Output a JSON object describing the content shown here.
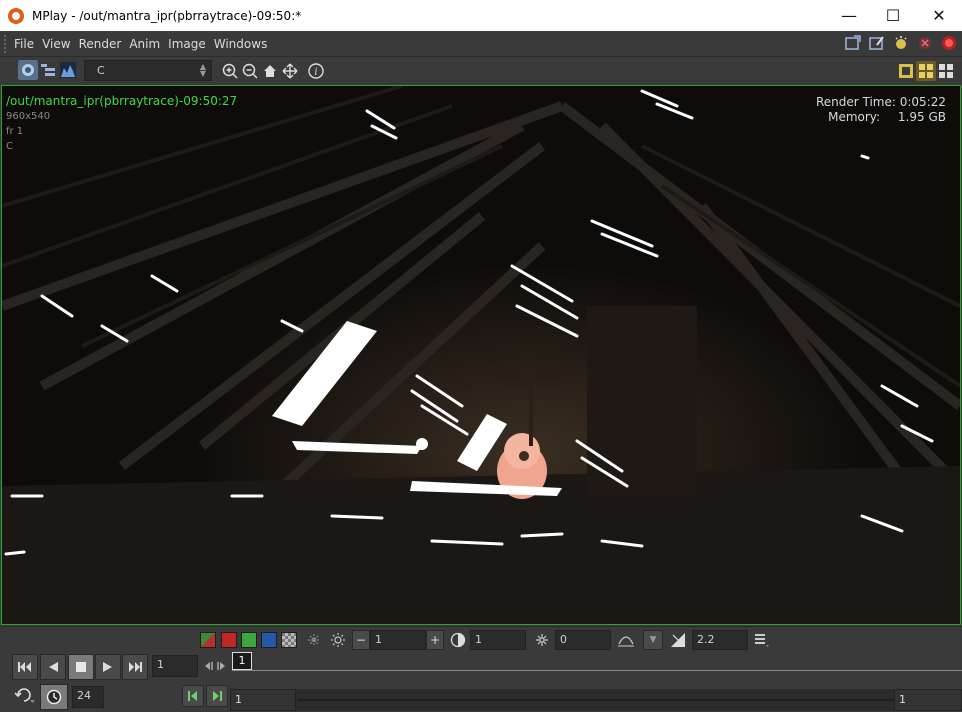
{
  "window": {
    "title": "MPlay - /out/mantra_ipr(pbrraytrace)-09:50:*",
    "minimize": "—",
    "maximize": "☐",
    "close": "✕"
  },
  "menu": [
    "File",
    "View",
    "Render",
    "Anim",
    "Image",
    "Windows"
  ],
  "toolbar": {
    "channel": "C",
    "info_icon": "i"
  },
  "viewport": {
    "path": "/out/mantra_ipr(pbrraytrace)-09:50:27",
    "resolution": "960x540",
    "frame": "fr 1",
    "plane": "C",
    "render_time_label": "Render Time:",
    "render_time_value": "0:05:22",
    "memory_label": "Memory:",
    "memory_value": "1.95 GB"
  },
  "image_controls": {
    "minus": "−",
    "plus": "+",
    "exposure": "1",
    "brightness": "1",
    "zero_value": "0",
    "gamma": "2.2"
  },
  "playback": {
    "frame": "1",
    "fps": "24",
    "current_frame": "1",
    "range_start": "1",
    "range_end": "1"
  },
  "colors": {
    "accent_green": "#3ddc3d",
    "viewport_border": "#2aa52a",
    "bg": "#3a3a3a",
    "field_bg": "#2b2b2b"
  }
}
